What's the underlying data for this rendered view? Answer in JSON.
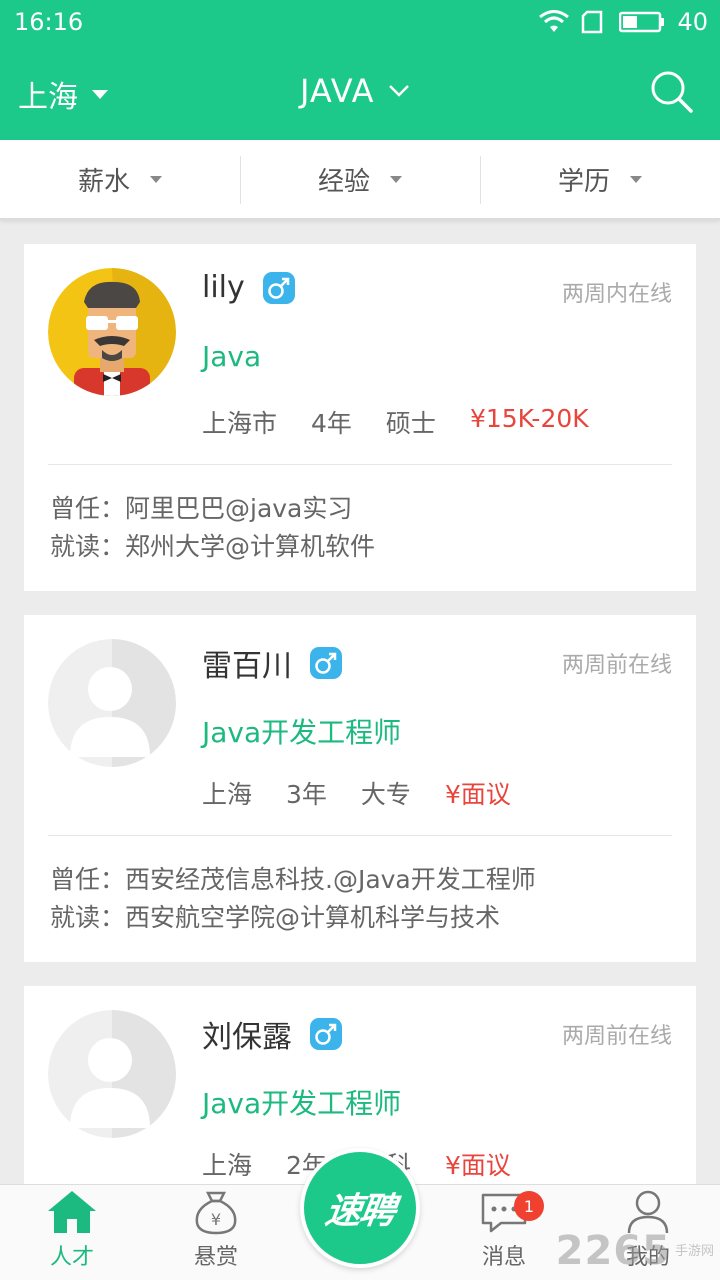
{
  "status_bar": {
    "time": "16:16",
    "battery": "40"
  },
  "header": {
    "city": "上海",
    "job": "JAVA"
  },
  "filters": [
    "薪水",
    "经验",
    "学历"
  ],
  "candidates": [
    {
      "name": "lily",
      "online": "两周内在线",
      "title": "Java",
      "city": "上海市",
      "experience": "4年",
      "education": "硕士",
      "salary": "¥15K-20K",
      "worked": "曾任：阿里巴巴@java实习",
      "studied": "就读：郑州大学@计算机软件"
    },
    {
      "name": "雷百川",
      "online": "两周前在线",
      "title": "Java开发工程师",
      "city": "上海",
      "experience": "3年",
      "education": "大专",
      "salary": "¥面议",
      "worked": "曾任：西安经茂信息科技.@Java开发工程师",
      "studied": "就读：西安航空学院@计算机科学与技术"
    },
    {
      "name": "刘保露",
      "online": "两周前在线",
      "title": "Java开发工程师",
      "city": "上海",
      "experience": "2年",
      "education": "本科",
      "salary": "¥面议"
    }
  ],
  "tabs": {
    "talent": "人才",
    "reward": "悬赏",
    "center": "速聘",
    "messages": "消息",
    "messages_badge": "1",
    "mine": "我的"
  },
  "watermark": {
    "number": "2265",
    "text": "手游网"
  },
  "colors": {
    "brand": "#1cc88a",
    "salary": "#e8453c",
    "title": "#1cb980"
  }
}
